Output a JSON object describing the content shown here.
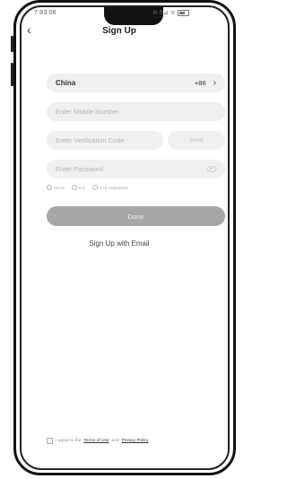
{
  "status_bar": {
    "time": "7:93:06",
    "icons": "⊖ 5⊿ ᯤ"
  },
  "header": {
    "back_icon": "‹",
    "title": "Sign Up"
  },
  "country": {
    "name": "China",
    "code": "+86",
    "chevron": "›"
  },
  "mobile": {
    "placeholder": "Enter Mobile Number"
  },
  "verification": {
    "placeholder": "Enter Verification Code",
    "send_label": "Send"
  },
  "password": {
    "placeholder": "Enter Password",
    "rules": [
      "Aa-Zz",
      "0-9",
      "6-16 Characters"
    ]
  },
  "done_label": "Done",
  "email_link": "Sign Up with Email",
  "agreement": {
    "prefix": "I agree to the",
    "terms": "Terms of Use",
    "and": "and",
    "privacy": "Privacy Policy"
  },
  "colors": {
    "done_button": "#a6a6a6",
    "field_background": "#f0f0f0"
  }
}
